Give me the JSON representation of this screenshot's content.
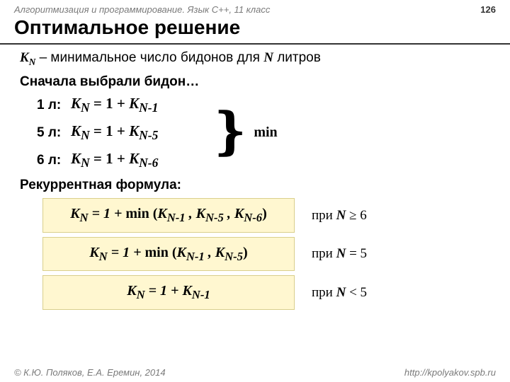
{
  "header": {
    "course": "Алгоритмизация и программирование. Язык C++, 11 класс",
    "page_number": "126"
  },
  "title": "Оптимальное решение",
  "definition": {
    "sym": "K",
    "sub": "N",
    "dash": " – ",
    "text": "минимальное число бидонов для ",
    "nvar": "N",
    "text2": " литров"
  },
  "lead": "Сначала выбрали бидон…",
  "cases": [
    {
      "label": "1 л:",
      "lhs_sub": "N",
      "rhs_sub": "N-1"
    },
    {
      "label": "5 л:",
      "lhs_sub": "N",
      "rhs_sub": "N-5"
    },
    {
      "label": "6 л:",
      "lhs_sub": "N",
      "rhs_sub": "N-6"
    }
  ],
  "min_label": "min",
  "recurrent_label": "Рекуррентная формула:",
  "formulas": [
    {
      "expr_html": "K<sub>N</sub> = 1 + <span class='rom'>min (</span>K<sub>N-1</sub> , K<sub>N-5</sub> , K<sub>N-6</sub><span class='rom'>)</span>",
      "cond_pre": "при ",
      "cond_var": "N",
      "cond_op": " ≥ 6"
    },
    {
      "expr_html": "K<sub>N</sub> = 1 + <span class='rom'>min (</span>K<sub>N-1</sub> , K<sub>N-5</sub><span class='rom'>)</span>",
      "cond_pre": "при ",
      "cond_var": "N",
      "cond_op": " = 5"
    },
    {
      "expr_html": "K<sub>N</sub> = 1 + K<sub>N-1</sub>",
      "cond_pre": "при ",
      "cond_var": "N",
      "cond_op": " < 5"
    }
  ],
  "footer": {
    "copyright": "© К.Ю. Поляков, Е.А. Еремин, 2014",
    "url": "http://kpolyakov.spb.ru"
  }
}
